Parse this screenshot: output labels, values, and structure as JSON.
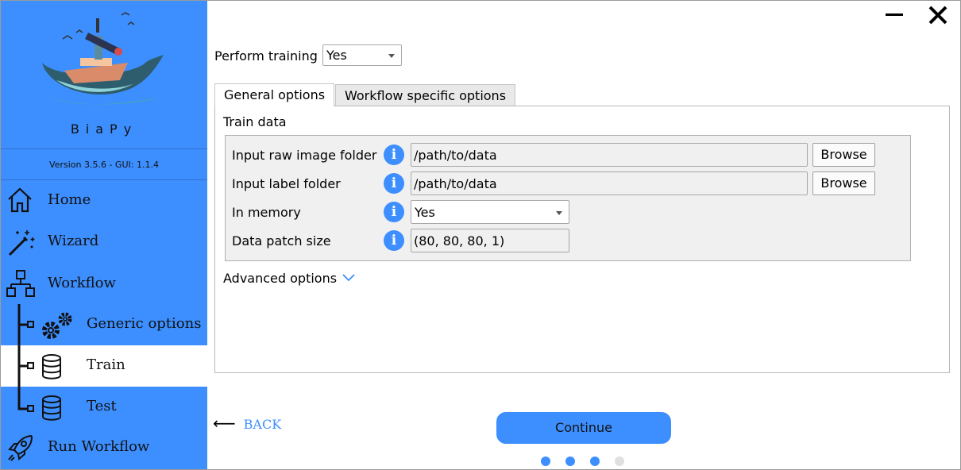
{
  "app": {
    "brand": "BiaPy",
    "version": "Version 3.5.6 - GUI: 1.1.4"
  },
  "window": {
    "minimize_icon": "minimize-icon",
    "close_icon": "close-icon"
  },
  "sidebar": {
    "items": [
      {
        "label": "Home",
        "icon": "home-icon"
      },
      {
        "label": "Wizard",
        "icon": "magic-wand-icon"
      },
      {
        "label": "Workflow",
        "icon": "workflow-tree-icon"
      },
      {
        "label": "Generic options",
        "icon": "gears-icon"
      },
      {
        "label": "Train",
        "icon": "database-icon",
        "active": true
      },
      {
        "label": "Test",
        "icon": "database-icon"
      },
      {
        "label": "Run Workflow",
        "icon": "rocket-icon"
      }
    ]
  },
  "main": {
    "perform_training": {
      "label": "Perform training",
      "value": "Yes"
    },
    "tabs": [
      {
        "label": "General options",
        "active": true
      },
      {
        "label": "Workflow specific options",
        "active": false
      }
    ],
    "train_data": {
      "title": "Train data",
      "rows": [
        {
          "label": "Input raw image folder",
          "value": "/path/to/data",
          "button": "Browse"
        },
        {
          "label": "Input label folder",
          "value": "/path/to/data",
          "button": "Browse"
        },
        {
          "label": "In memory",
          "value": "Yes"
        },
        {
          "label": "Data patch size",
          "value": "(80, 80, 80, 1)"
        }
      ],
      "info_glyph": "i"
    },
    "advanced_options": "Advanced options"
  },
  "footer": {
    "back_arrow": "⟵",
    "back_label": "BACK",
    "continue_label": "Continue",
    "steps_total": 4,
    "steps_completed": 3
  },
  "colors": {
    "accent": "#3d8fff",
    "inactive_dot": "#e0e0e0"
  }
}
